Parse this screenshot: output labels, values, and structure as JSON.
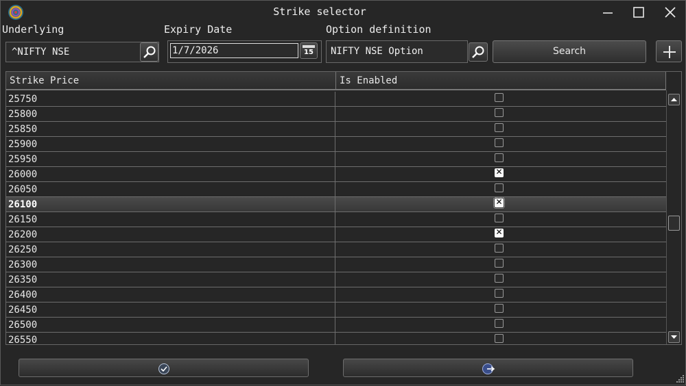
{
  "window": {
    "title": "Strike selector"
  },
  "underlying": {
    "label": "Underlying",
    "value": "^NIFTY NSE"
  },
  "expiry": {
    "label": "Expiry Date",
    "value": "1/7/2026",
    "calendar_day": "15"
  },
  "option_def": {
    "label": "Option definition",
    "value": "NIFTY NSE Option"
  },
  "search": {
    "label": "Search"
  },
  "grid": {
    "columns": [
      "Strike Price",
      "Is Enabled"
    ],
    "rows": [
      {
        "strike": "25750",
        "enabled": false
      },
      {
        "strike": "25800",
        "enabled": false
      },
      {
        "strike": "25850",
        "enabled": false
      },
      {
        "strike": "25900",
        "enabled": false
      },
      {
        "strike": "25950",
        "enabled": false
      },
      {
        "strike": "26000",
        "enabled": true
      },
      {
        "strike": "26050",
        "enabled": false
      },
      {
        "strike": "26100",
        "enabled": true,
        "selected": true
      },
      {
        "strike": "26150",
        "enabled": false
      },
      {
        "strike": "26200",
        "enabled": true
      },
      {
        "strike": "26250",
        "enabled": false
      },
      {
        "strike": "26300",
        "enabled": false
      },
      {
        "strike": "26350",
        "enabled": false
      },
      {
        "strike": "26400",
        "enabled": false
      },
      {
        "strike": "26450",
        "enabled": false
      },
      {
        "strike": "26500",
        "enabled": false
      },
      {
        "strike": "26550",
        "enabled": false
      }
    ]
  },
  "icons": {
    "ok": "check-circle-icon",
    "exit": "exit-arrow-icon",
    "search": "magnifier-icon",
    "calendar": "calendar-icon",
    "add": "plus-icon"
  }
}
